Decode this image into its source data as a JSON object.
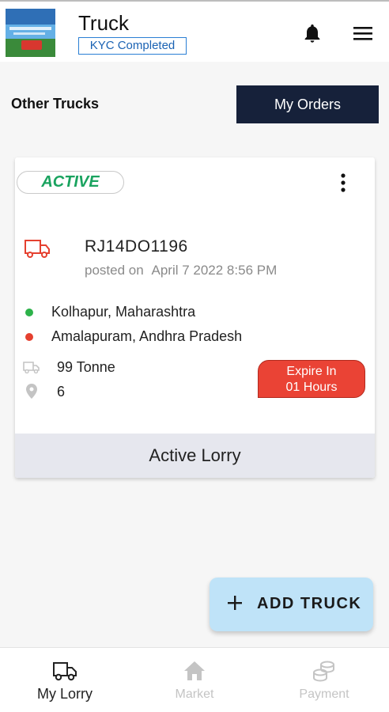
{
  "header": {
    "title": "Truck",
    "kyc_status": "KYC Completed",
    "logo_icon": "app-logo",
    "notification_icon": "bell-icon",
    "menu_icon": "hamburger-menu-icon"
  },
  "toolbar": {
    "other_trucks_label": "Other Trucks",
    "my_orders_label": "My Orders"
  },
  "card": {
    "status": "ACTIVE",
    "truck_number": "RJ14DO1196",
    "posted_prefix": "posted on",
    "posted_date": "April 7 2022 8:56 PM",
    "from": "Kolhapur,  Maharashtra",
    "to": "Amalapuram,  Andhra Pradesh",
    "capacity": "99 Tonne",
    "count": "6",
    "expire_line1": "Expire In",
    "expire_line2": "01 Hours",
    "footer": "Active Lorry"
  },
  "fab": {
    "label": "ADD TRUCK"
  },
  "nav": {
    "items": [
      {
        "label": "My Lorry",
        "icon": "truck-icon"
      },
      {
        "label": "Market",
        "icon": "home-icon"
      },
      {
        "label": "Payment",
        "icon": "coins-icon"
      }
    ]
  },
  "colors": {
    "active_green": "#1aa35f",
    "expire_red": "#ea4335",
    "dark_button": "#16213a",
    "fab_bg": "#bfe3f8",
    "kyc_blue": "#2a7fd4"
  }
}
